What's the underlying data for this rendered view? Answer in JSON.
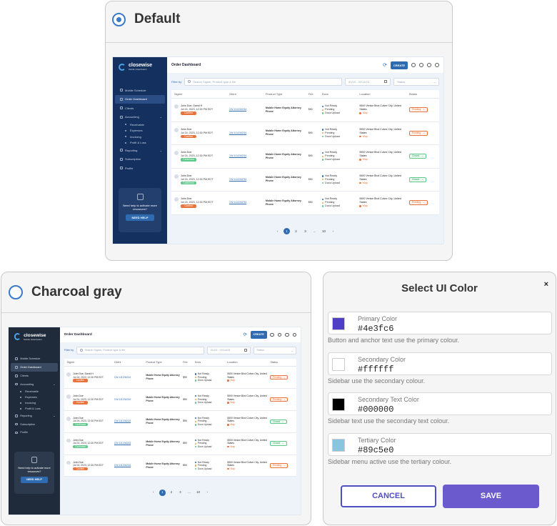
{
  "themes": [
    {
      "label": "Default",
      "selected": true,
      "colors": {
        "sidebar": "#14305e",
        "active": "#2a4d85",
        "accent": "#2e6bb0",
        "help_box": "#233f6e"
      }
    },
    {
      "label": "Charcoal gray",
      "selected": false,
      "colors": {
        "sidebar": "#1f2a3a",
        "active": "#3a4a60",
        "accent": "#2e6bb0",
        "help_box": "#2d3a4d"
      }
    }
  ],
  "app": {
    "brand": "closewise",
    "brand_tagline": "Mobile Notarization",
    "page_title": "Order Dashboard",
    "create_label": "CREATE",
    "nav": [
      {
        "label": "Mobile Schedule",
        "active": false,
        "sub": false
      },
      {
        "label": "Order Dashboard",
        "active": true,
        "sub": false
      },
      {
        "label": "Clients",
        "active": false,
        "sub": false
      },
      {
        "label": "Accounting",
        "active": false,
        "sub": false,
        "expand": true
      },
      {
        "label": "Receivable",
        "active": false,
        "sub": true
      },
      {
        "label": "Expenses",
        "active": false,
        "sub": true
      },
      {
        "label": "Invoicing",
        "active": false,
        "sub": true
      },
      {
        "label": "Profit & Loss",
        "active": false,
        "sub": true
      },
      {
        "label": "Reporting",
        "active": false,
        "sub": false,
        "expand": true
      },
      {
        "label": "Subscription",
        "active": false,
        "sub": false
      },
      {
        "label": "Profile",
        "active": false,
        "sub": false
      }
    ],
    "help_text": "Need help to activate more resources?",
    "help_button": "NEED HELP",
    "filter_label": "Filter by",
    "search_placeholder": "Search Signer, Product type & file",
    "date_placeholder": "01/23 - 02/14/24",
    "status_placeholder": "Status",
    "columns": [
      "Signer",
      "Client",
      "Product Type",
      "Fee",
      "Docs",
      "Location",
      "Status"
    ],
    "rows": [
      {
        "signer": "John Doe, David H",
        "date": "Jul 24, 2023, 12:30 PM EDT",
        "pill": "Confirm",
        "pill_type": "o",
        "client": "CW-111234234",
        "product": "Mobile Home Equity Attorney Phone",
        "fee": "$90",
        "docs": [
          "Not Ready",
          "Pending",
          "Docs Upload"
        ],
        "location": "5500 Venice Blvd Culver City, United States",
        "map": "Map",
        "status": "Pending",
        "status_type": "p"
      },
      {
        "signer": "John Doe",
        "date": "Jul 24, 2023, 12:30 PM EDT",
        "pill": "Confirm",
        "pill_type": "o",
        "client": "CW-111234234",
        "product": "Mobile Home Equity Attorney Phone",
        "fee": "$90",
        "docs": [
          "Not Ready",
          "Pending",
          "Docs Upload"
        ],
        "location": "5500 Venice Blvd Culver City, United States",
        "map": "Map",
        "status": "Pending",
        "status_type": "p"
      },
      {
        "signer": "John Doe",
        "date": "Jul 24, 2023, 12:30 PM EDT",
        "pill": "Confirmed",
        "pill_type": "g",
        "client": "CW-111234234",
        "product": "Mobile Home Equity Attorney Phone",
        "fee": "$90",
        "docs": [
          "Not Ready",
          "Pending",
          "Docs Upload"
        ],
        "location": "5500 Venice Blvd Culver City, United States",
        "map": "Map",
        "status": "Closed",
        "status_type": "cl"
      },
      {
        "signer": "John Doe",
        "date": "Jul 24, 2023, 12:30 PM EDT",
        "pill": "Confirmed",
        "pill_type": "g",
        "client": "CW-111234234",
        "product": "Mobile Home Equity Attorney Phone",
        "fee": "$90",
        "docs": [
          "Not Ready",
          "Pending",
          "Docs Upload"
        ],
        "location": "5500 Venice Blvd Culver City, United States",
        "map": "Map",
        "status": "Closed",
        "status_type": "cl"
      },
      {
        "signer": "John Doe",
        "date": "Jul 24, 2023, 12:30 PM EDT",
        "pill": "Confirm",
        "pill_type": "o",
        "client": "CW-111234234",
        "product": "Mobile Home Equity Attorney Phone",
        "fee": "$90",
        "docs": [
          "Not Ready",
          "Pending",
          "Docs Upload"
        ],
        "location": "5500 Venice Blvd Culver City, United States",
        "map": "Map",
        "status": "Pending",
        "status_type": "p"
      }
    ],
    "doc_colors": [
      "#2e6bb0",
      "#e8a33b",
      "#5ec78a"
    ],
    "pages": [
      "1",
      "2",
      "3",
      "...",
      "10"
    ]
  },
  "dialog": {
    "title": "Select UI Color",
    "close": "×",
    "fields": [
      {
        "label": "Primary Color",
        "value": "#4e3fc6",
        "help": "Button and anchor text use the primary colour."
      },
      {
        "label": "Secondary Color",
        "value": "#ffffff",
        "help": "Sidebar use the secondary colour."
      },
      {
        "label": "Secondary Text Color",
        "value": "#000000",
        "help": "Sidebar text use the secondary text colour."
      },
      {
        "label": "Tertiary Color",
        "value": "#89c5e0",
        "help": "Sidebar menu active use the tertiary colour."
      }
    ],
    "cancel": "CANCEL",
    "save": "SAVE"
  }
}
